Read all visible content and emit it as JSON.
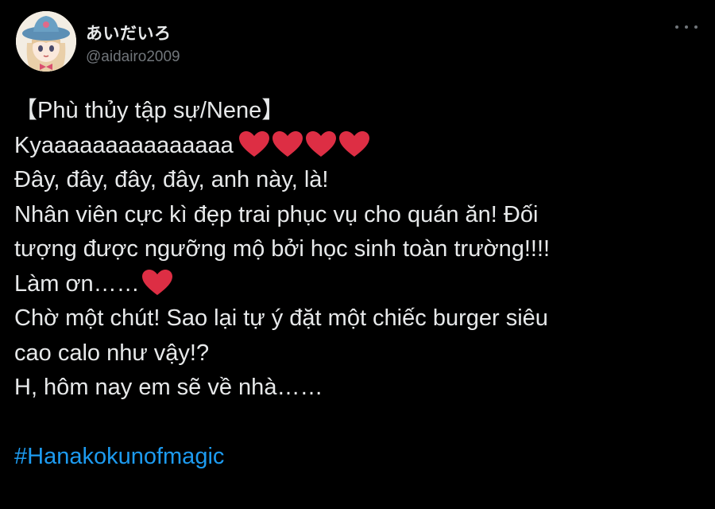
{
  "tweet": {
    "display_name": "あいだいろ",
    "handle": "@aidairo2009",
    "lines": [
      "【Phù thủy tập sự/Nene】",
      "Kyaaaaaaaaaaaaaaa",
      "Đây, đây, đây, đây, anh này, là!",
      "Nhân viên cực kì đẹp trai phục vụ cho quán ăn! Đối",
      "tượng được ngưỡng mộ bởi học sinh toàn trường!!!!",
      "Làm ơn……",
      "Chờ một chút! Sao lại tự ý đặt một chiếc burger siêu",
      "cao calo như vậy!?",
      "H, hôm nay em sẽ về nhà……"
    ],
    "hashtag": "#Hanakokunofmagic",
    "heart_emoji_count_line2": 4,
    "heart_emoji_count_line6": 1
  },
  "icons": {
    "more": "more-horizontal-icon",
    "heart": "red-heart-icon"
  },
  "colors": {
    "background": "#000000",
    "text": "#e7e9ea",
    "secondary": "#71767b",
    "link": "#1d9bf0",
    "heart": "#dd2e44"
  }
}
